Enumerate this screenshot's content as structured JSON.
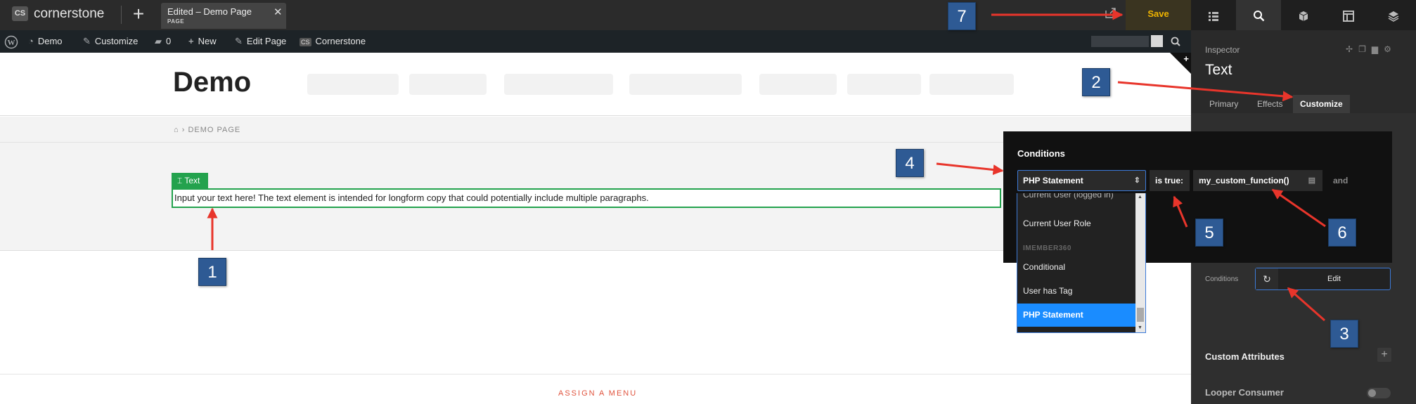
{
  "topbar": {
    "logo_mark": "CS",
    "logo_text": "cornerstone",
    "new_label": "+",
    "tab_title": "Edited – Demo Page",
    "tab_type": "PAGE",
    "tab_close": "✕",
    "save_label": "Save"
  },
  "panel_icons": [
    "list-icon",
    "search-icon",
    "cube-icon",
    "layout-icon",
    "layers-icon"
  ],
  "wpbar": {
    "site_name": "Demo",
    "customize": "Customize",
    "comments": "0",
    "new": "New",
    "edit_page": "Edit Page",
    "cornerstone": "Cornerstone"
  },
  "site": {
    "title": "Demo",
    "breadcrumb": "› DEMO PAGE",
    "text_tag": "Text",
    "text_content": "Input your text here! The text element is intended for longform copy that could potentially include multiple paragraphs.",
    "assign_menu": "ASSIGN A MENU"
  },
  "inspector": {
    "label": "Inspector",
    "title": "Text",
    "tabs": [
      "Primary",
      "Effects",
      "Customize"
    ],
    "active_tab": "Customize",
    "conditions_label": "Conditions",
    "conditions_edit": "Edit",
    "custom_attributes": "Custom Attributes",
    "looper_consumer": "Looper Consumer"
  },
  "conditions_popup": {
    "title": "Conditions",
    "type_selected": "PHP Statement",
    "operator": "is true:",
    "value": "my_custom_function()",
    "joiner": "and",
    "dropdown": {
      "items": [
        {
          "label": "Current User (logged in)",
          "kind": "item"
        },
        {
          "label": "Current User Role",
          "kind": "item"
        },
        {
          "label": "IMEMBER360",
          "kind": "group"
        },
        {
          "label": "Conditional",
          "kind": "item"
        },
        {
          "label": "User has Tag",
          "kind": "item"
        },
        {
          "label": "PHP Statement",
          "kind": "selected"
        }
      ]
    }
  },
  "callouts": [
    "1",
    "2",
    "3",
    "4",
    "5",
    "6",
    "7"
  ],
  "colors": {
    "accent_blue": "#3d7bd9",
    "callout_blue": "#2e5a94",
    "arrow_red": "#e8352b",
    "element_green": "#23a24d",
    "save_gold": "#f0b400"
  }
}
